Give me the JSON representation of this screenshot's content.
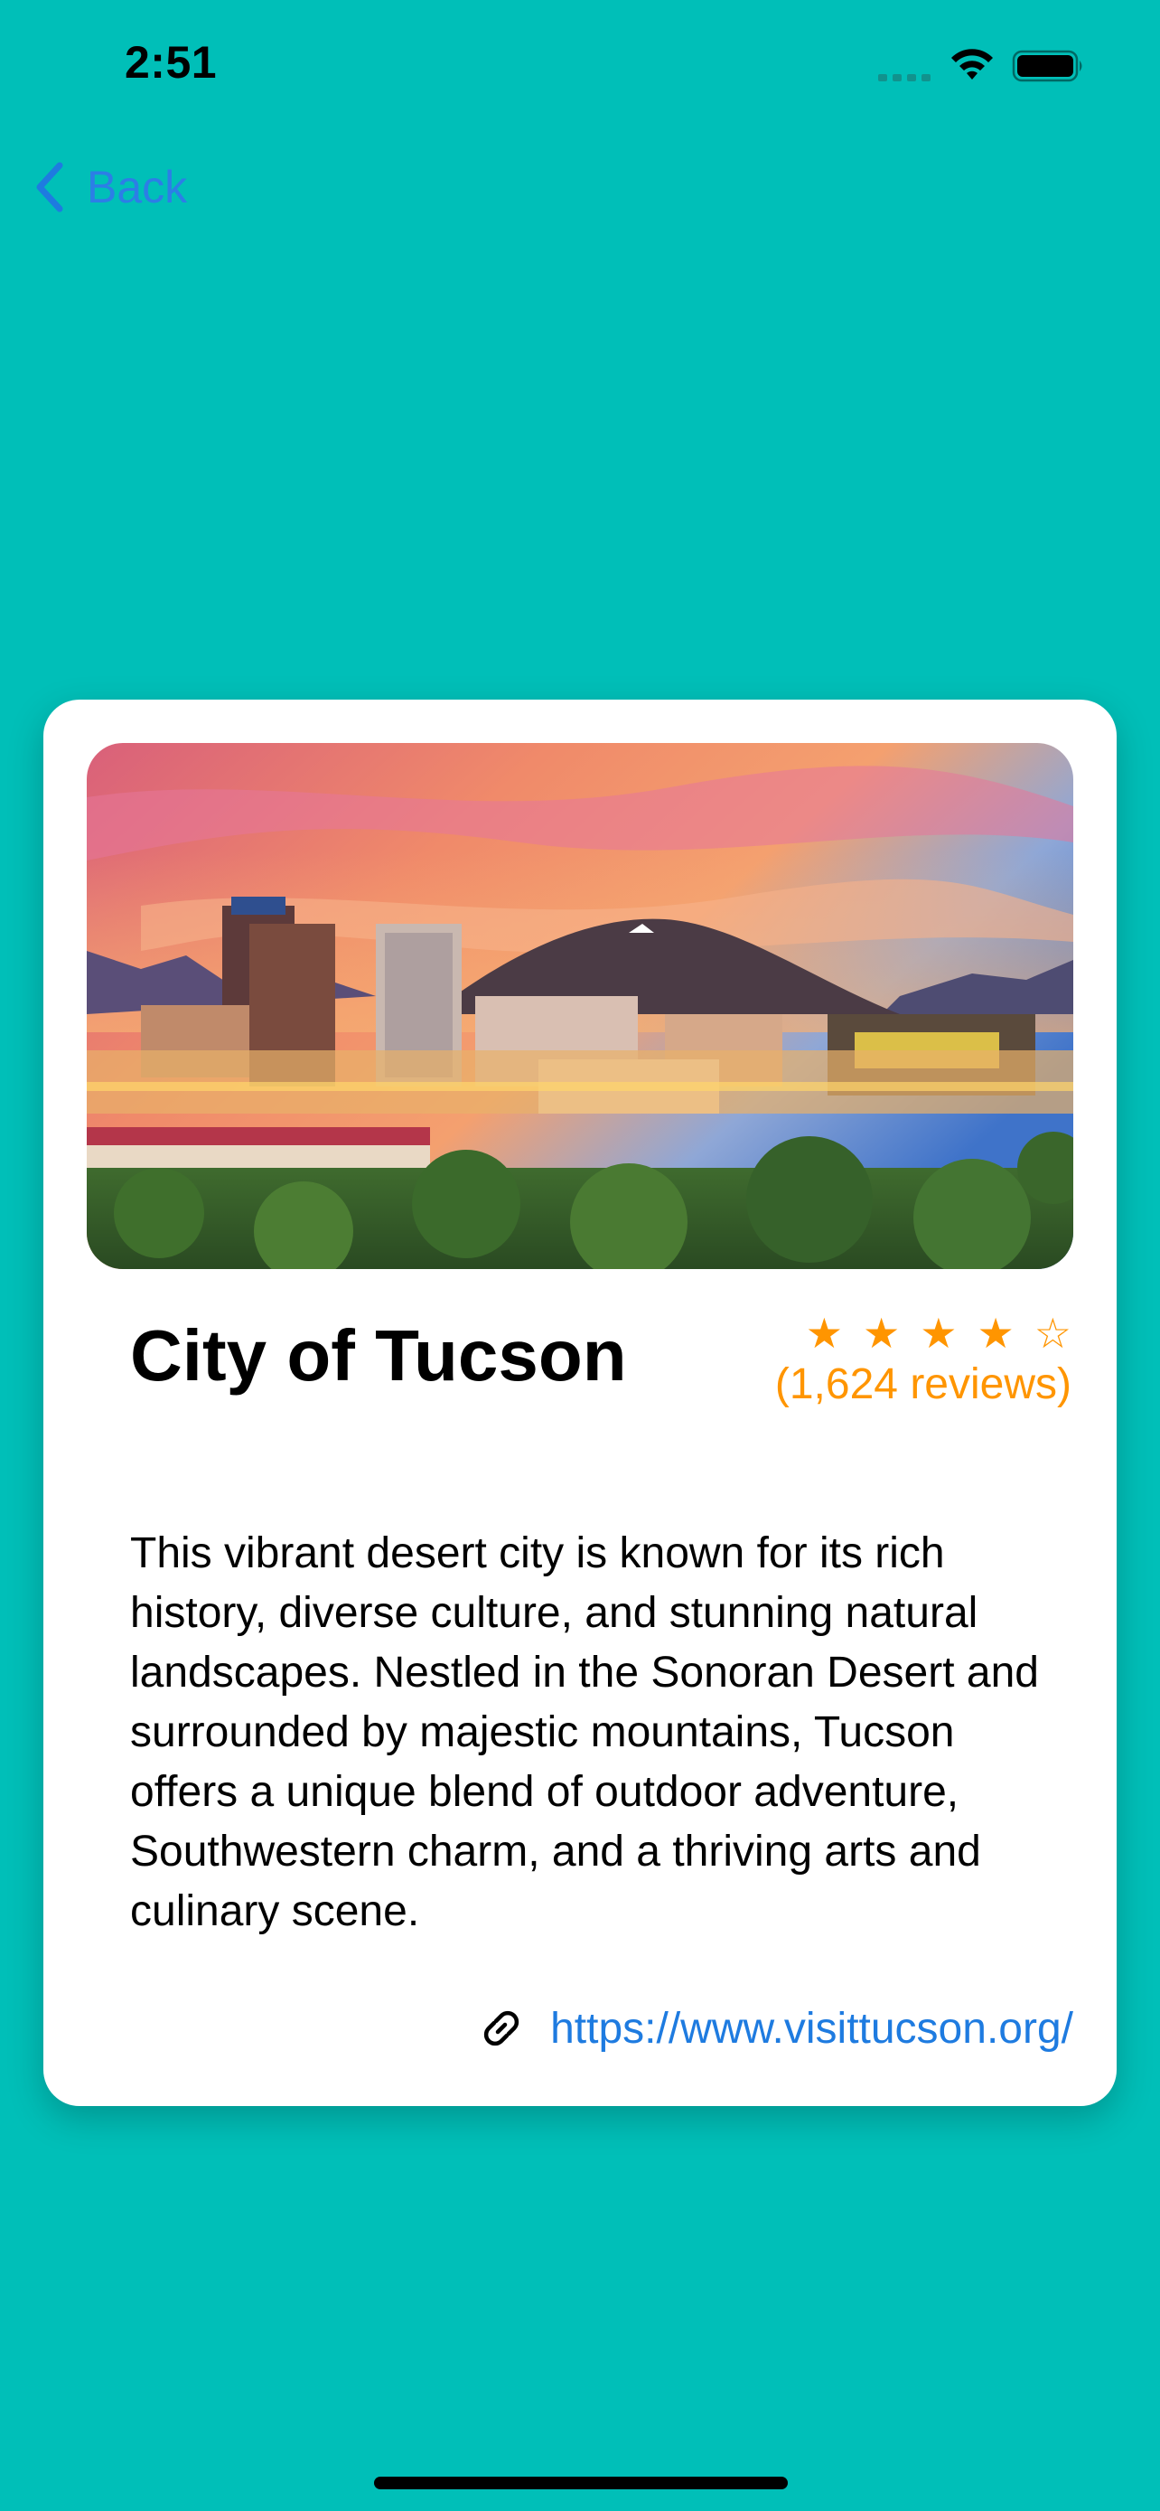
{
  "status_bar": {
    "time": "2:51",
    "wifi_icon": "wifi-icon",
    "battery_icon": "battery-icon"
  },
  "nav": {
    "back_label": "Back",
    "back_icon": "chevron-left-icon"
  },
  "card": {
    "image_alt": "Tucson skyline at sunset with A Mountain",
    "title": "City of Tucson",
    "rating": {
      "stars": 4,
      "max_stars": 5,
      "reviews_text": "(1,624 reviews)"
    },
    "description": "This vibrant desert city is known for its rich history, diverse culture, and stunning natural landscapes. Nestled in the Sonoran Desert and surrounded by majestic mountains, Tucson offers a unique blend of outdoor adventure, Southwestern charm, and a thriving arts and culinary scene.",
    "link": {
      "icon": "link-icon",
      "url": "https://www.visittucson.org/"
    }
  },
  "colors": {
    "background": "#00BFB8",
    "accent": "#1E7BE0",
    "star": "#FF9500"
  }
}
